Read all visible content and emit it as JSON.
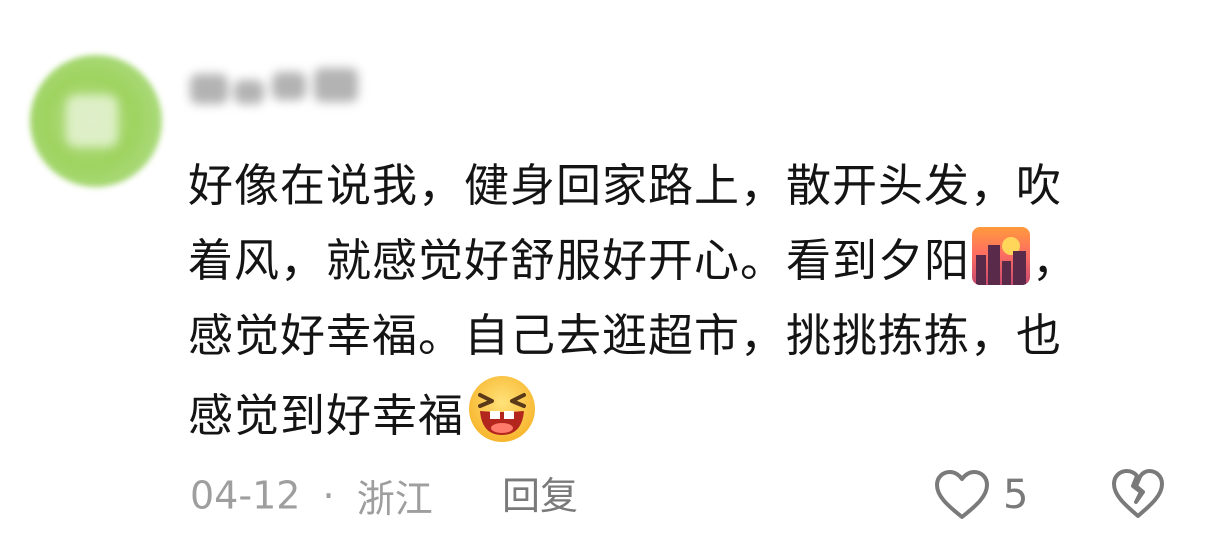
{
  "comment": {
    "text_lines": [
      "好像在说我，健身回家路上，散开头发，吹",
      "着风，就感觉好舒服好开心。看到夕阳",
      "，",
      "感觉好幸福。自己去逛超市，挑挑拣拣，也",
      "感觉到好幸福"
    ],
    "emojis": [
      "sunset-emoji",
      "laughing-emoji"
    ],
    "date": "04-12",
    "separator": "·",
    "location": "浙江",
    "reply_label": "回复",
    "like_count": "5",
    "colors": {
      "text": "#141414",
      "meta": "#9e9e9e",
      "action": "#7a7a7a",
      "avatar": "#9ed35f"
    }
  }
}
